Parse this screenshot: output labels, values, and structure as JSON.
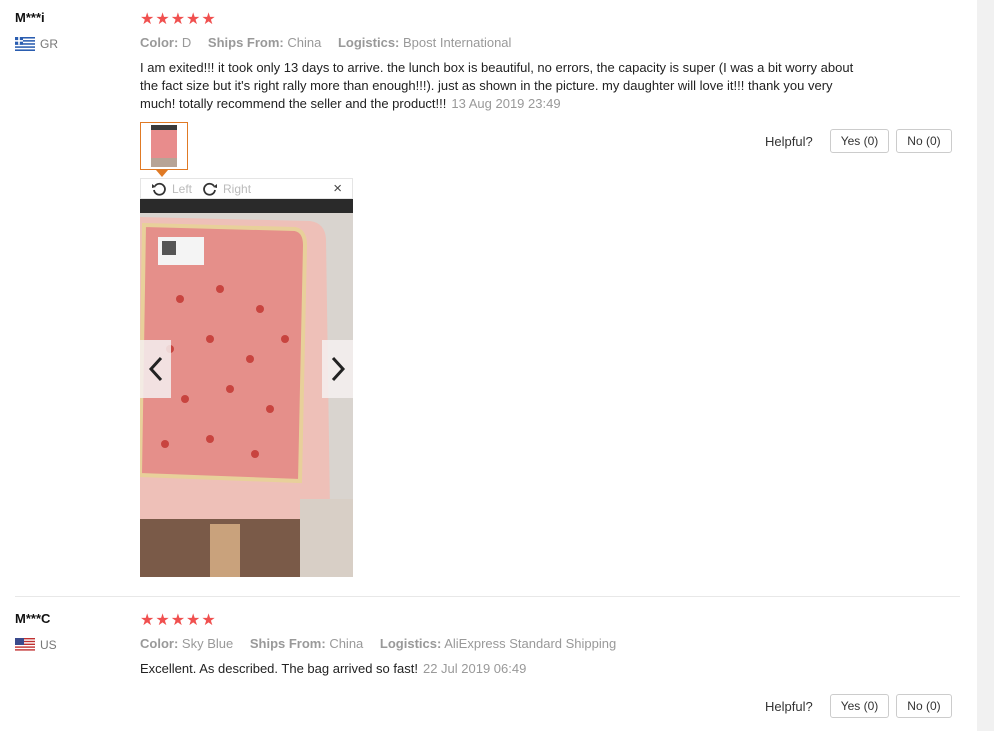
{
  "reviews": [
    {
      "user": "M***i",
      "country": "GR",
      "stars": "★★★★★",
      "color_label": "Color:",
      "color": "D",
      "ships_label": "Ships From:",
      "ships": "China",
      "logistics_label": "Logistics:",
      "logistics": "Bpost International",
      "text": "I am exited!!! it took only 13 days to arrive. the lunch box is beautiful, no errors, the capacity is super (I was a bit worry about the fact size but it's right rally more than enough!!!). just as shown in the picture. my daughter will love it!!! thank you very much! totally recommend the seller and the product!!!",
      "date": "13 Aug 2019 23:49",
      "helpful_label": "Helpful?",
      "yes_label": "Yes (0)",
      "no_label": "No (0)"
    },
    {
      "user": "M***C",
      "country": "US",
      "stars": "★★★★★",
      "color_label": "Color:",
      "color": "Sky Blue",
      "ships_label": "Ships From:",
      "ships": "China",
      "logistics_label": "Logistics:",
      "logistics": "AliExpress Standard Shipping",
      "text": "Excellent. As described. The bag arrived so fast!",
      "date": "22 Jul 2019 06:49",
      "helpful_label": "Helpful?",
      "yes_label": "Yes (0)",
      "no_label": "No (0)"
    }
  ],
  "viewer": {
    "left_label": "Left",
    "right_label": "Right",
    "close": "×"
  },
  "icons": {
    "flag_gr": "greece-flag-icon",
    "flag_us": "usa-flag-icon",
    "rotate_left": "rotate-left-icon",
    "rotate_right": "rotate-right-icon",
    "prev": "chevron-left-icon",
    "next": "chevron-right-icon"
  },
  "colors": {
    "stars": "#f0504f",
    "thumb_border": "#e07a25",
    "muted": "#999999"
  }
}
